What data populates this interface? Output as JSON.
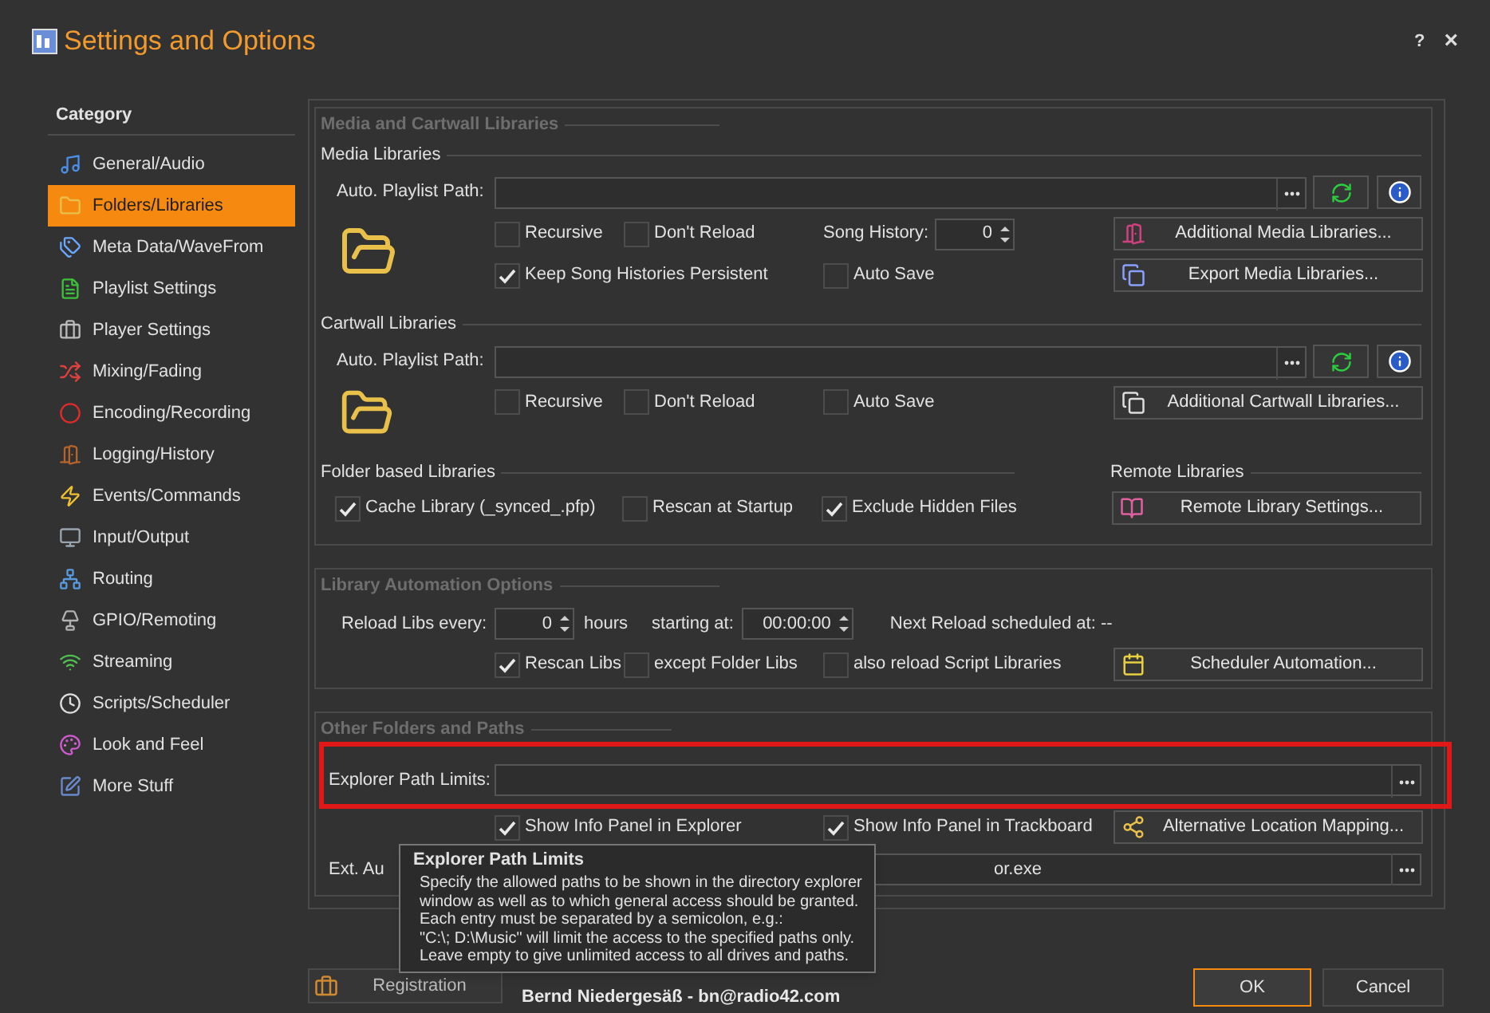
{
  "window": {
    "title": "Settings and Options",
    "help": "?",
    "close": "×"
  },
  "sidebar": {
    "heading": "Category",
    "items": [
      {
        "label": "General/Audio",
        "selected": false
      },
      {
        "label": "Folders/Libraries",
        "selected": true
      },
      {
        "label": "Meta Data/WaveFrom",
        "selected": false
      },
      {
        "label": "Playlist Settings",
        "selected": false
      },
      {
        "label": "Player Settings",
        "selected": false
      },
      {
        "label": "Mixing/Fading",
        "selected": false
      },
      {
        "label": "Encoding/Recording",
        "selected": false
      },
      {
        "label": "Logging/History",
        "selected": false
      },
      {
        "label": "Events/Commands",
        "selected": false
      },
      {
        "label": "Input/Output",
        "selected": false
      },
      {
        "label": "Routing",
        "selected": false
      },
      {
        "label": "GPIO/Remoting",
        "selected": false
      },
      {
        "label": "Streaming",
        "selected": false
      },
      {
        "label": "Scripts/Scheduler",
        "selected": false
      },
      {
        "label": "Look and Feel",
        "selected": false
      },
      {
        "label": "More Stuff",
        "selected": false
      }
    ]
  },
  "media_cartwall": {
    "title": "Media and Cartwall Libraries",
    "media_libraries": {
      "title": "Media Libraries",
      "path_label": "Auto. Playlist Path:",
      "options": [
        {
          "label": "Recursive",
          "checked": false
        },
        {
          "label": "Don't Reload",
          "checked": false
        },
        {
          "label": "Keep Song Histories Persistent",
          "checked": true
        },
        {
          "label": "Auto Save",
          "checked": false
        }
      ],
      "song_history": {
        "label": "Song History:",
        "value": "0"
      },
      "buttons": [
        "Additional Media Libraries...",
        "Export Media Libraries..."
      ]
    },
    "cartwall_libraries": {
      "title": "Cartwall Libraries",
      "path_label": "Auto. Playlist Path:",
      "options": [
        {
          "label": "Recursive",
          "checked": false
        },
        {
          "label": "Don't Reload",
          "checked": false
        },
        {
          "label": "Auto Save",
          "checked": false
        }
      ],
      "buttons": [
        "Additional Cartwall Libraries..."
      ]
    },
    "folder_based": {
      "title": "Folder based Libraries",
      "options": [
        {
          "label": "Cache Library (_synced_.pfp)",
          "checked": true
        },
        {
          "label": "Rescan at Startup",
          "checked": false
        },
        {
          "label": "Exclude Hidden Files",
          "checked": true
        }
      ]
    },
    "remote": {
      "title": "Remote Libraries",
      "button": "Remote Library Settings..."
    }
  },
  "automation": {
    "title": "Library Automation Options",
    "reload_label": "Reload Libs every:",
    "reload_value": "0",
    "hours": "hours",
    "start_label": "starting at:",
    "start_value": "00:00:00",
    "next_reload": "Next Reload scheduled at: --",
    "options": [
      {
        "label": "Rescan Libs",
        "checked": true
      },
      {
        "label": "except Folder Libs",
        "checked": false
      },
      {
        "label": "also reload Script Libraries",
        "checked": false
      }
    ],
    "button": "Scheduler Automation..."
  },
  "other": {
    "title": "Other Folders and Paths",
    "explorer_path": {
      "label": "Explorer Path Limits:",
      "highlighted": true
    },
    "options": [
      {
        "label": "Show Info Panel in Explorer",
        "checked": true
      },
      {
        "label": "Show Info Panel in Trackboard",
        "checked": true
      }
    ],
    "button": "Alternative Location Mapping...",
    "ext": {
      "label": "Ext. Au",
      "value": "or.exe"
    }
  },
  "tooltip": {
    "title": "Explorer Path Limits",
    "text": "Specify the allowed paths to be shown in the directory explorer\nwindow as well as to which general access should be granted.\nEach entry must be separated by a semicolon, e.g.:\n\"C:\\; D:\\Music\" will limit the access to the specified paths only.\nLeave empty to give unlimited access to all drives and paths."
  },
  "footer": {
    "registration": "Registration",
    "author": "Bernd Niedergesäß - bn@radio42.com",
    "ok": "OK",
    "cancel": "Cancel"
  }
}
